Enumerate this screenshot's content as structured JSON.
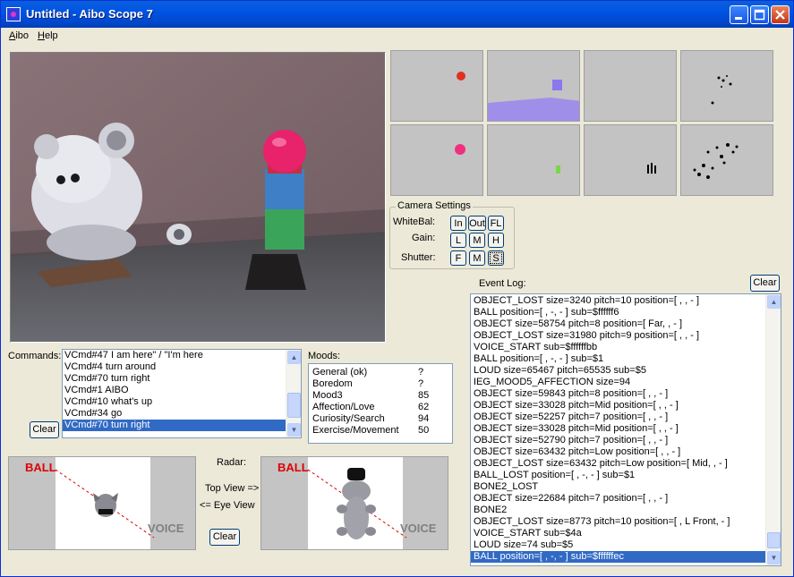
{
  "window": {
    "title": "Untitled - Aibo Scope 7"
  },
  "menubar": {
    "items": [
      "Aibo",
      "Help"
    ],
    "underline": [
      "A",
      "H"
    ],
    "rest": [
      "ibo",
      "elp"
    ]
  },
  "camera_settings": {
    "title": "Camera Settings",
    "whitebal": {
      "label": "WhiteBal:",
      "buttons": [
        "In",
        "Out",
        "FL"
      ]
    },
    "gain": {
      "label": "Gain:",
      "buttons": [
        "L",
        "M",
        "H"
      ]
    },
    "shutter": {
      "label": "Shutter:",
      "buttons": [
        "F",
        "M",
        "S"
      ]
    }
  },
  "commands": {
    "label": "Commands:",
    "clear": "Clear",
    "items": [
      "VCmd#47 I am here\" / \"I'm here",
      "VCmd#4 turn around",
      "VCmd#70 turn right",
      "VCmd#1 AIBO",
      "VCmd#10 what's up",
      "VCmd#34 go",
      "VCmd#70 turn right"
    ],
    "selected_index": 6
  },
  "moods": {
    "label": "Moods:",
    "items": [
      {
        "name": "General (ok)",
        "value": "?"
      },
      {
        "name": "Boredom",
        "value": "?"
      },
      {
        "name": "Mood3",
        "value": "85"
      },
      {
        "name": "Affection/Love",
        "value": "62"
      },
      {
        "name": "Curiosity/Search",
        "value": "94"
      },
      {
        "name": "Exercise/Movement",
        "value": "50"
      }
    ]
  },
  "radar": {
    "label": "Radar:",
    "top_view": "Top View =>",
    "eye_view": "<= Eye View",
    "clear": "Clear",
    "ball": "BALL",
    "voice": "VOICE"
  },
  "event_log": {
    "label": "Event Log:",
    "clear": "Clear",
    "items": [
      "OBJECT_LOST size=3240 pitch=10 position=[ , , - ]",
      "BALL   position=[ , -, - ] sub=$ffffff6",
      "OBJECT size=58754 pitch=8 position=[ Far, , - ]",
      "OBJECT_LOST size=31980 pitch=9 position=[ , , - ]",
      "VOICE_START    sub=$ffffffbb",
      "BALL   position=[ , -, - ] sub=$1",
      "LOUD size=65467 pitch=65535  sub=$5",
      "IEG_MOOD5_AFFECTION size=94",
      "OBJECT size=59843 pitch=8 position=[ , , - ]",
      "OBJECT size=33028 pitch=Mid position=[ , , - ]",
      "OBJECT size=52257 pitch=7 position=[ , , - ]",
      "OBJECT size=33028 pitch=Mid position=[ , , - ]",
      "OBJECT size=52790 pitch=7 position=[ , , - ]",
      "OBJECT size=63432 pitch=Low position=[ , , - ]",
      "OBJECT_LOST size=63432 pitch=Low position=[ Mid, , - ]",
      "BALL_LOST   position=[ , -, - ] sub=$1",
      "BONE2_LOST",
      "OBJECT size=22684 pitch=7 position=[ , , - ]",
      "BONE2",
      "OBJECT_LOST size=8773 pitch=10 position=[ , L Front, - ]",
      "VOICE_START    sub=$4a",
      "LOUD size=74   sub=$5",
      "BALL   position=[ , -, - ] sub=$ffffffec"
    ],
    "selected_index": 22
  }
}
